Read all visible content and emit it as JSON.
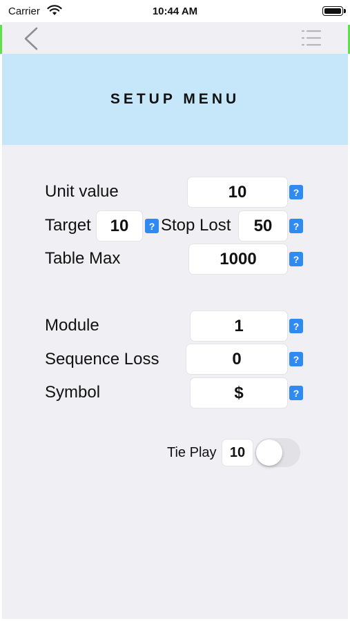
{
  "status_bar": {
    "carrier": "Carrier",
    "time": "10:44 AM"
  },
  "nav": {
    "back_icon": "chevron-left-icon",
    "menu_icon": "list-icon"
  },
  "header": {
    "title": "SETUP MENU",
    "background": "#c6e6f9"
  },
  "form": {
    "unit_value": {
      "label": "Unit value",
      "value": "10"
    },
    "target": {
      "label": "Target",
      "value": "10"
    },
    "stop_lost": {
      "label": "Stop Lost",
      "value": "50"
    },
    "table_max": {
      "label": "Table Max",
      "value": "1000"
    },
    "module": {
      "label": "Module",
      "value": "1"
    },
    "sequence_loss": {
      "label": "Sequence Loss",
      "value": "0"
    },
    "symbol": {
      "label": "Symbol",
      "value": "$"
    },
    "help_glyph": "?",
    "help_color": "#2f8bf2"
  },
  "tie_play": {
    "label": "Tie Play",
    "value": "10",
    "toggle_on": false
  }
}
